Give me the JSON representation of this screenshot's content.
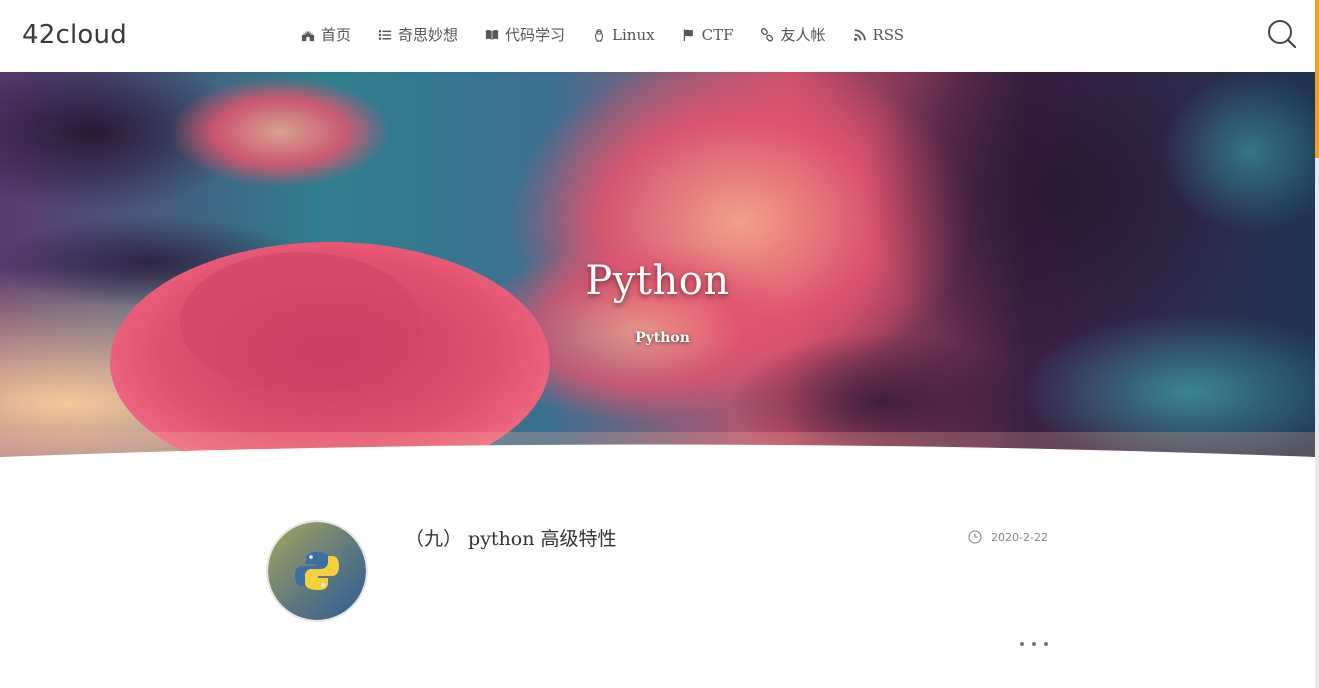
{
  "header": {
    "site_title": "42cloud",
    "nav": [
      {
        "label": "首页",
        "icon": "castle-icon"
      },
      {
        "label": "奇思妙想",
        "icon": "list-icon"
      },
      {
        "label": "代码学习",
        "icon": "book-icon"
      },
      {
        "label": "Linux",
        "icon": "penguin-icon"
      },
      {
        "label": "CTF",
        "icon": "flag-icon"
      },
      {
        "label": "友人帐",
        "icon": "link-icon"
      },
      {
        "label": "RSS",
        "icon": "rss-icon"
      }
    ],
    "search_icon": "search-icon"
  },
  "hero": {
    "title": "Python",
    "subtitle": "Python"
  },
  "posts": [
    {
      "title": "（九） python 高级特性",
      "date": "2020-2-22",
      "avatar": "python-logo-icon"
    }
  ],
  "colors": {
    "scroll_accent": "#f39c2c",
    "text_main": "#333333",
    "nav_text": "#555555"
  }
}
